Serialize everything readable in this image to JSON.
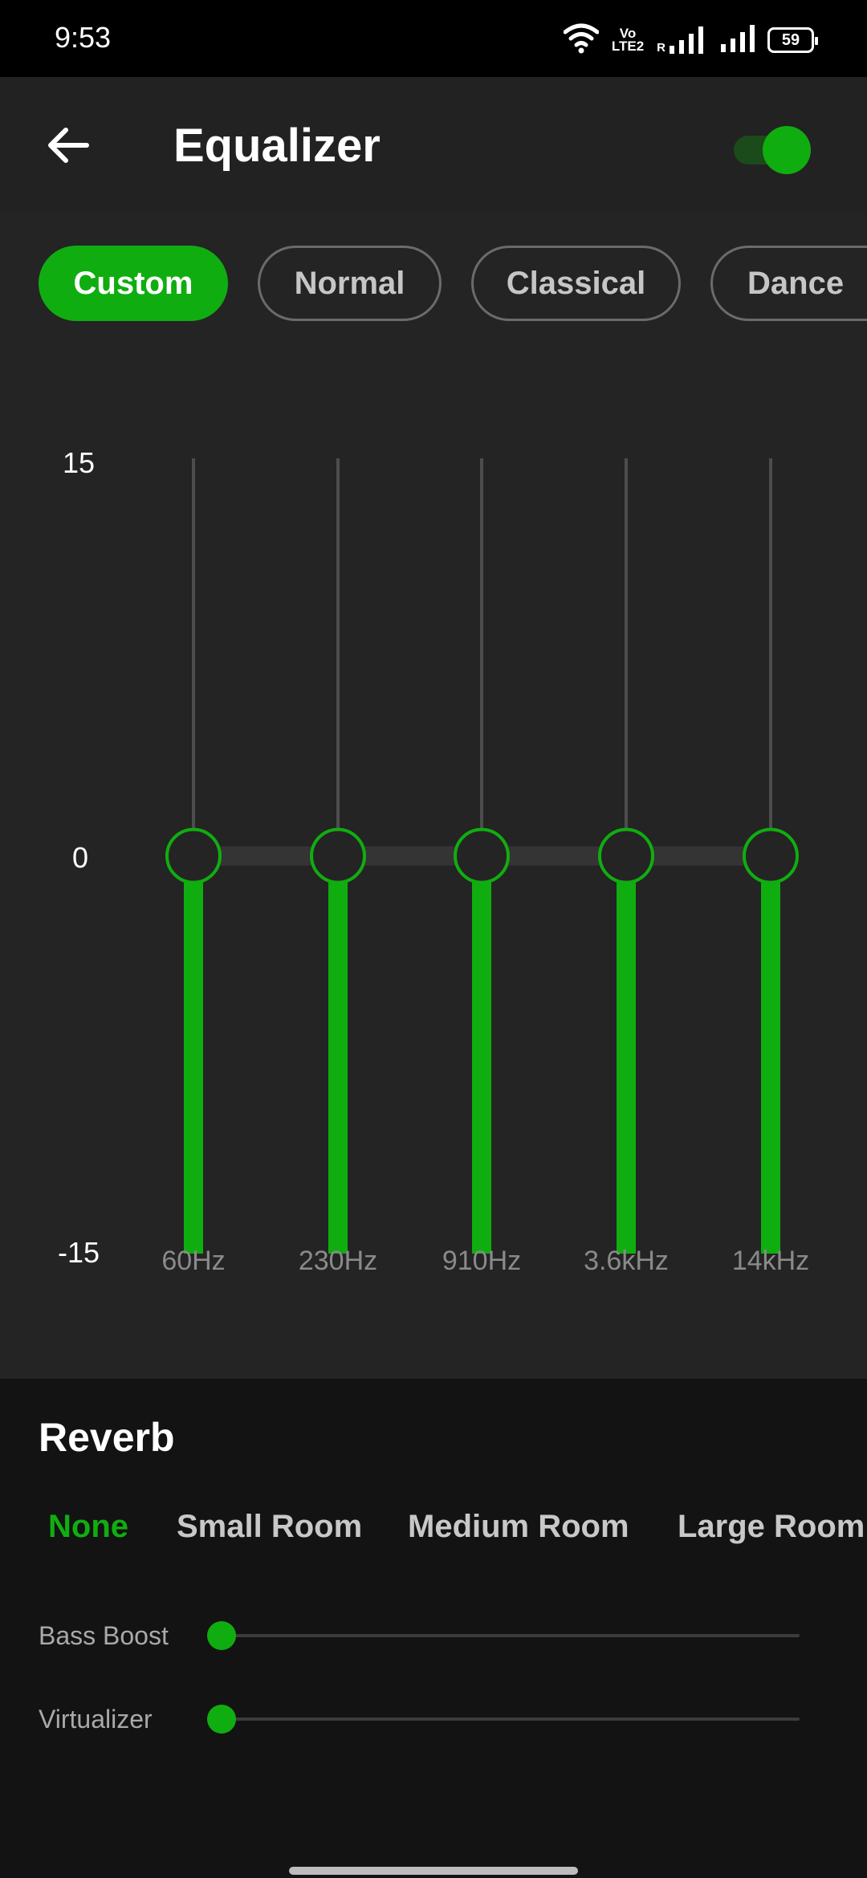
{
  "status_bar": {
    "time": "9:53",
    "battery": "59",
    "volte_top": "Vo",
    "volte_bottom": "LTE2",
    "roaming": "R",
    "icons": [
      "wifi-icon",
      "volte-icon",
      "signal-icon",
      "signal-icon",
      "battery-icon"
    ]
  },
  "header": {
    "title": "Equalizer",
    "back_icon": "arrow-left-icon",
    "toggle_on": true
  },
  "presets": [
    {
      "label": "Custom",
      "active": true
    },
    {
      "label": "Normal",
      "active": false
    },
    {
      "label": "Classical",
      "active": false
    },
    {
      "label": "Dance",
      "active": false
    }
  ],
  "equalizer": {
    "max_label": "15",
    "mid_label": "0",
    "min_label": "-15",
    "range": [
      -15,
      15
    ],
    "bands": [
      {
        "label": "60Hz",
        "value": 0
      },
      {
        "label": "230Hz",
        "value": 0
      },
      {
        "label": "910Hz",
        "value": 0
      },
      {
        "label": "3.6kHz",
        "value": 0
      },
      {
        "label": "14kHz",
        "value": 0
      }
    ]
  },
  "reverb": {
    "title": "Reverb",
    "options": [
      {
        "label": "None",
        "active": true
      },
      {
        "label": "Small Room",
        "active": false
      },
      {
        "label": "Medium Room",
        "active": false
      },
      {
        "label": "Large Room",
        "active": false
      }
    ]
  },
  "effects": {
    "bass_boost": {
      "label": "Bass Boost",
      "value": 0
    },
    "virtualizer": {
      "label": "Virtualizer",
      "value": 0
    }
  },
  "colors": {
    "accent": "#10ad10",
    "panel": "#242424",
    "background": "#131313"
  }
}
